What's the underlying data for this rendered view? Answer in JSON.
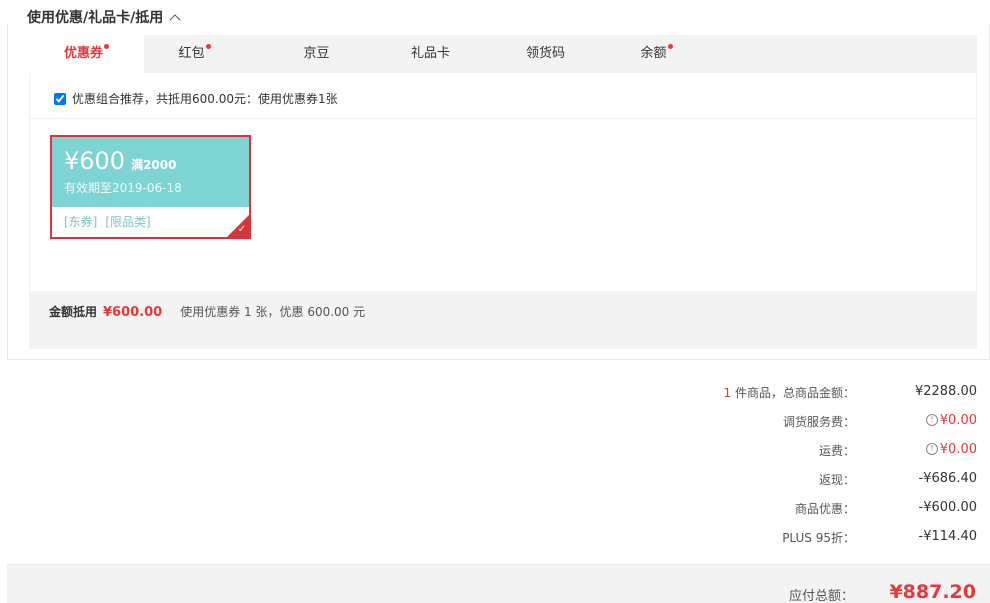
{
  "section": {
    "title": "使用优惠/礼品卡/抵用"
  },
  "tabs": [
    {
      "label": "优惠券",
      "active": true,
      "dot": true
    },
    {
      "label": "红包",
      "active": false,
      "dot": true
    },
    {
      "label": "京豆",
      "active": false,
      "dot": false
    },
    {
      "label": "礼品卡",
      "active": false,
      "dot": false
    },
    {
      "label": "领货码",
      "active": false,
      "dot": false
    },
    {
      "label": "余额",
      "active": false,
      "dot": true
    }
  ],
  "recommend": {
    "label": "优惠组合推荐，共抵用600.00元：使用优惠券1张",
    "checked": true
  },
  "coupon": {
    "amount": "¥600",
    "condition": "满2000",
    "expire": "有效期至2019-06-18",
    "tag1": "[东券]",
    "tag2": "[限品类]"
  },
  "summary": {
    "label": "金额抵用",
    "amount": "¥600.00",
    "desc": "使用优惠券 1 张，优惠 600.00 元"
  },
  "totals": {
    "items_count": "1",
    "items_label": " 件商品，总商品金额：",
    "items_value": "¥2288.00",
    "service_label": "调货服务费：",
    "service_value": "¥0.00",
    "shipping_label": "运费：",
    "shipping_value": "¥0.00",
    "cashback_label": "返现：",
    "cashback_value": "-¥686.40",
    "discount_label": "商品优惠：",
    "discount_value": "-¥600.00",
    "plus_label": "PLUS 95折：",
    "plus_value": "-¥114.40"
  },
  "pay": {
    "label": "应付总额：",
    "value": "¥887.20"
  },
  "colors": {
    "accent": "#e4393c",
    "coupon": "#7dd4d2"
  }
}
